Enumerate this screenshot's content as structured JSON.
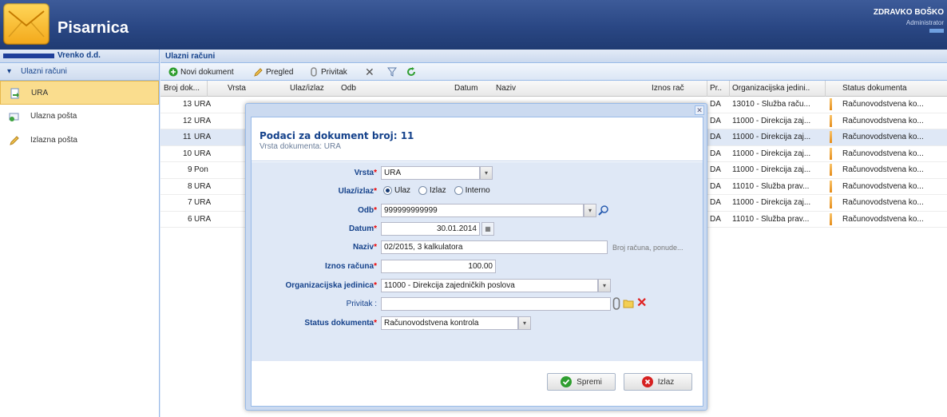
{
  "header": {
    "app_title": "Pisarnica",
    "user_name": "ZDRAVKO BOŠKO",
    "user_role": "Administrator",
    "colors": {
      "header_bg": "#2a4784",
      "logo_bg": "#f3a81a"
    }
  },
  "left": {
    "company": "Vrenko d.d.",
    "group": "Ulazni računi",
    "items": [
      {
        "label": "URA",
        "icon": "document-arrow-icon",
        "selected": true
      },
      {
        "label": "Ulazna pošta",
        "icon": "mail-in-icon",
        "selected": false
      },
      {
        "label": "Izlazna pošta",
        "icon": "pencil-icon",
        "selected": false
      }
    ]
  },
  "main": {
    "title": "Ulazni računi",
    "toolbar": {
      "new_label": "Novi dokument",
      "view_label": "Pregled",
      "attach_label": "Privitak"
    },
    "columns": [
      "Broj dok...",
      "Vrsta",
      "Ulaz/izlaz",
      "Odb",
      "Datum",
      "Naziv",
      "Iznos rač",
      "Pr..",
      "Organizacijska jedini...",
      "Status dokumenta"
    ],
    "rows": [
      {
        "num": "13",
        "type": "URA",
        "pr": "DA",
        "org": "13010 - Služba raču...",
        "status": "Računovodstvena ko..."
      },
      {
        "num": "12",
        "type": "URA",
        "pr": "DA",
        "org": "11000 - Direkcija zaj...",
        "status": "Računovodstvena ko..."
      },
      {
        "num": "11",
        "type": "URA",
        "pr": "DA",
        "org": "11000 - Direkcija zaj...",
        "status": "Računovodstvena ko..."
      },
      {
        "num": "10",
        "type": "URA",
        "pr": "DA",
        "org": "11000 - Direkcija zaj...",
        "status": "Računovodstvena ko..."
      },
      {
        "num": "9",
        "type": "Pon",
        "pr": "DA",
        "org": "11000 - Direkcija zaj...",
        "status": "Računovodstvena ko..."
      },
      {
        "num": "8",
        "type": "URA",
        "pr": "DA",
        "org": "11010 - Služba prav...",
        "status": "Računovodstvena ko..."
      },
      {
        "num": "7",
        "type": "URA",
        "pr": "DA",
        "org": "11000 - Direkcija zaj...",
        "status": "Računovodstvena ko..."
      },
      {
        "num": "6",
        "type": "URA",
        "pr": "DA",
        "org": "11010 - Služba prav...",
        "status": "Računovodstvena ko..."
      }
    ]
  },
  "modal": {
    "title": "Podaci za dokument broj: 11",
    "subtitle": "Vrsta dokumenta: URA",
    "fields": {
      "vrsta": {
        "label": "Vrsta",
        "value": "URA"
      },
      "ulaz_izlaz": {
        "label": "Ulaz/izlaz",
        "options": [
          "Ulaz",
          "Izlaz",
          "Interno"
        ],
        "selected": "Ulaz"
      },
      "odb": {
        "label": "Odb",
        "value": "999999999999"
      },
      "datum": {
        "label": "Datum",
        "value": "30.01.2014"
      },
      "naziv": {
        "label": "Naziv",
        "value": "02/2015, 3 kalkulatora",
        "hint": "Broj računa, ponude..."
      },
      "iznos": {
        "label": "Iznos računa",
        "value": "100.00"
      },
      "org": {
        "label": "Organizacijska jedinica",
        "value": "11000 - Direkcija zajedničkih poslova"
      },
      "privitak": {
        "label": "Privitak :",
        "value": ""
      },
      "status": {
        "label": "Status dokumenta",
        "value": "Računovodstvena kontrola"
      }
    },
    "save_label": "Spremi",
    "exit_label": "Izlaz"
  }
}
